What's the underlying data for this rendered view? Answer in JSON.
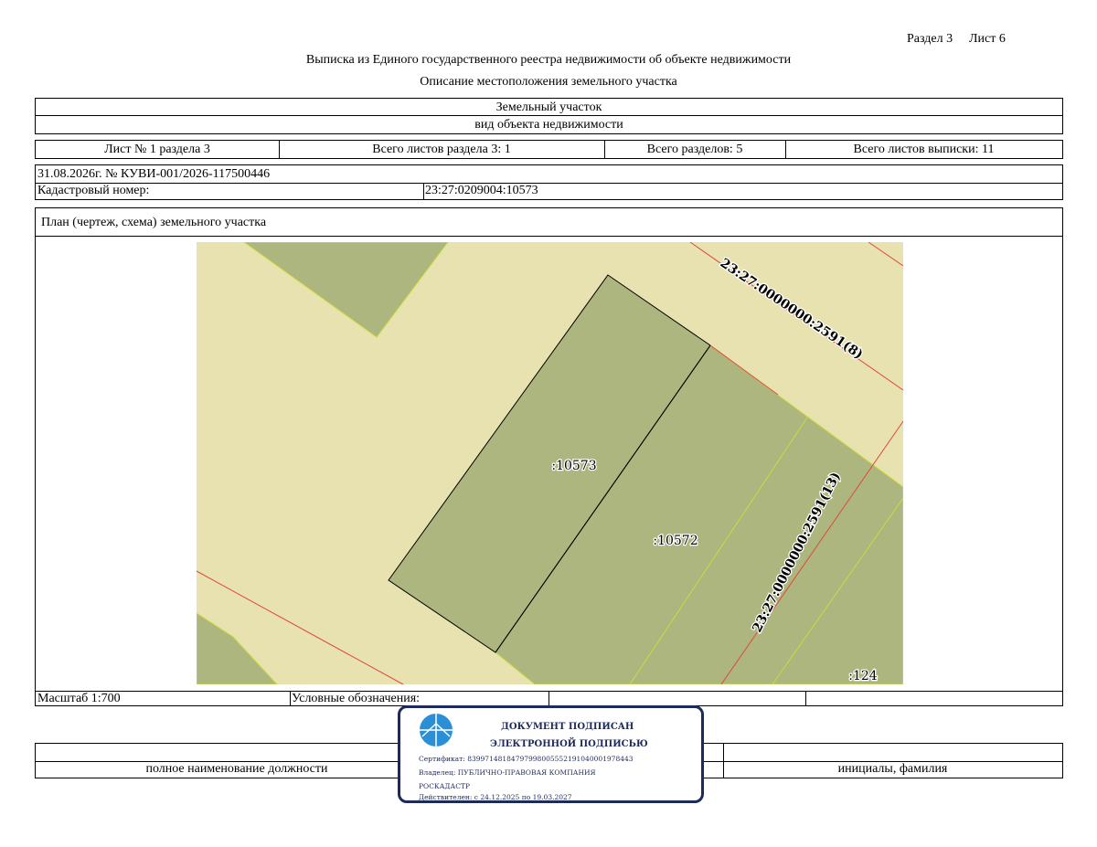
{
  "header": {
    "section": "Раздел 3",
    "sheet": "Лист 6",
    "title": "Выписка из Единого государственного реестра недвижимости об объекте недвижимости",
    "subtitle": "Описание местоположения земельного участка"
  },
  "object": {
    "type": "Земельный участок",
    "type_caption": "вид объекта недвижимости"
  },
  "sheets": {
    "sheet_no": "Лист № 1 раздела 3",
    "total_section_sheets": "Всего листов раздела 3: 1",
    "total_sections": "Всего разделов: 5",
    "total_extract_sheets": "Всего листов выписки: 11"
  },
  "record": {
    "date_number": "31.08.2026г. № КУВИ-001/2026-117500446",
    "cadastral_label": "Кадастровый номер:",
    "cadastral_value": "23:27:0209004:10573"
  },
  "plan": {
    "title": "План (чертеж, схема) земельного участка",
    "labels": {
      "parcel_main": ":10573",
      "parcel_adjacent": ":10572",
      "parcel_corner": ":124",
      "road_top": "23:27:0000000:2591(8)",
      "road_right": "23:27:0000000:2591(13)"
    },
    "colors": {
      "background": "#e8e2b0",
      "parcel_fill": "#aeb67f",
      "boundary_red": "#e0483c",
      "boundary_yellow": "#c8dc3c"
    }
  },
  "footer": {
    "scale": "Масштаб 1:700",
    "legend_label": "Условные обозначения:",
    "position_caption": "полное наименование должности",
    "name_caption": "инициалы, фамилия"
  },
  "signature": {
    "line1": "ДОКУМЕНТ ПОДПИСАН",
    "line2": "ЭЛЕКТРОННОЙ ПОДПИСЬЮ",
    "certificate": "Сертификат: 83997148184797998005552191040001978443",
    "owner_line1": "Владелец: ПУБЛИЧНО-ПРАВОВАЯ КОМПАНИЯ",
    "owner_line2": "РОСКАДАСТР",
    "validity": "Действителен: с 24.12.2025 по 19.03.2027",
    "color": "#1d2a5c"
  }
}
